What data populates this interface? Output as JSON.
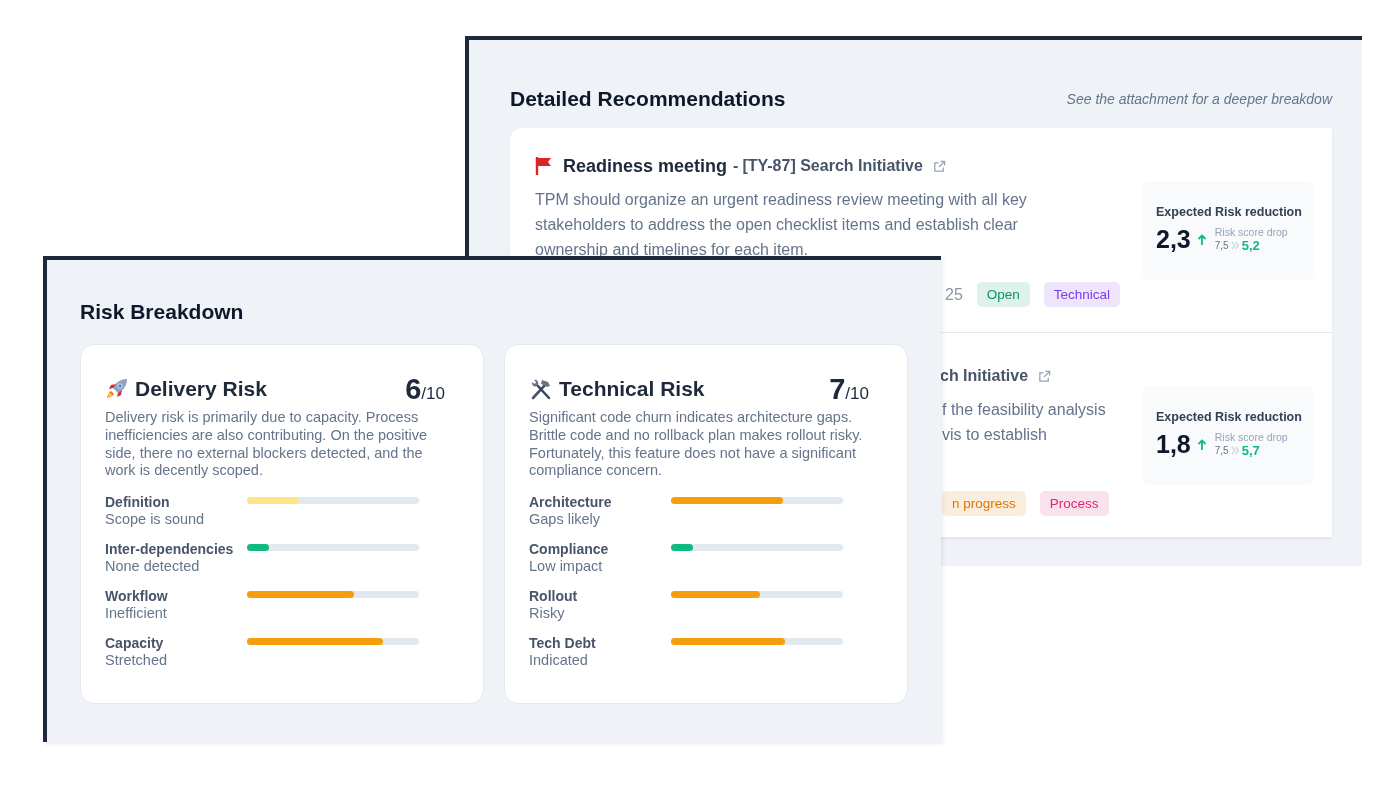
{
  "recommendations": {
    "title": "Detailed Recommendations",
    "hint": "See the attachment for a deeper breakdow",
    "items": [
      {
        "title": "Readiness meeting",
        "separator": "-",
        "ticket": "[TY-87] Search Initiative",
        "description": [
          "TPM should organize an urgent readiness review meeting with all key",
          "stakeholders to address the open checklist items and establish clear",
          "ownership and timelines for each item."
        ],
        "meta": "25",
        "tags": [
          {
            "label": "Open",
            "color": "#059669"
          },
          {
            "label": "Technical",
            "color": "#7c3aed"
          }
        ],
        "reduction": {
          "label": "Expected Risk reduction",
          "value": "2,3",
          "drop_label": "Risk score drop",
          "from": "7,5",
          "to": "5,2"
        },
        "kind": "full"
      },
      {
        "kind": "partial",
        "ticket": "ch Initiative",
        "description": [
          "f the feasibility analysis",
          "vis to establish"
        ],
        "tags": [
          {
            "label": "n progress",
            "color": "#d97706"
          },
          {
            "label": "Process",
            "color": "#db2777"
          }
        ],
        "reduction": {
          "label": "Expected Risk reduction",
          "value": "1,8",
          "drop_label": "Risk score drop",
          "from": "7,5",
          "to": "5,7"
        }
      }
    ]
  },
  "breakdown": {
    "title": "Risk Breakdown",
    "cards": [
      {
        "kind": "rocket",
        "title": "Delivery Risk",
        "score": "6",
        "out_of": "/10",
        "description": "Delivery risk is primarily due to capacity. Process inefficiencies are also contributing. On the positive side, there no external blockers detected, and the work is decently scoped.",
        "factors": [
          {
            "name": "Definition",
            "status": "Scope is sound",
            "level": 0.3,
            "color": "#fde68a"
          },
          {
            "name": "Inter-dependencies",
            "status": "None detected",
            "level": 0.13,
            "color": "#10b981"
          },
          {
            "name": "Workflow",
            "status": "Inefficient",
            "level": 0.62,
            "color": "#f59e0b"
          },
          {
            "name": "Capacity",
            "status": "Stretched",
            "level": 0.79,
            "color": "#f59e0b"
          }
        ]
      },
      {
        "kind": "tools",
        "title": "Technical Risk",
        "score": "7",
        "out_of": "/10",
        "description": "Significant code churn indicates architecture gaps. Brittle code and no rollback plan makes rollout risky. Fortunately, this feature does not have a significant compliance concern.",
        "factors": [
          {
            "name": "Architecture",
            "status": "Gaps likely",
            "level": 0.65,
            "color": "#f59e0b"
          },
          {
            "name": "Compliance",
            "status": "Low impact",
            "level": 0.13,
            "color": "#10b981"
          },
          {
            "name": "Rollout",
            "status": "Risky",
            "level": 0.52,
            "color": "#f59e0b"
          },
          {
            "name": "Tech Debt",
            "status": "Indicated",
            "level": 0.66,
            "color": "#f59e0b"
          }
        ]
      }
    ]
  }
}
